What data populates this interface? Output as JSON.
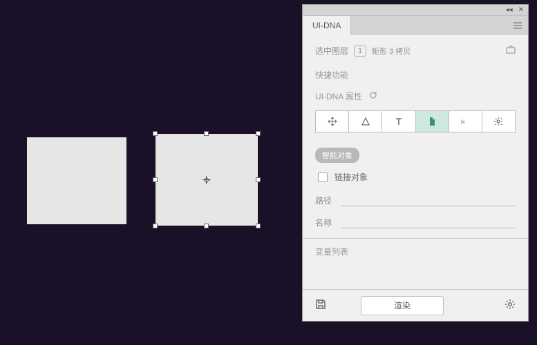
{
  "panel": {
    "tab_label": "UI-DNA",
    "selected_layer_label": "选中图层",
    "selected_count": "1",
    "selected_layer_name": "矩形 3 拷贝",
    "quick_functions_title": "快捷功能",
    "attributes_title": "UI-DNA 属性",
    "smart_object_pill": "智能对象",
    "link_object_label": "链接对象",
    "path_label": "路径",
    "path_value": "",
    "name_label": "名称",
    "name_value": "",
    "variable_list_title": "变量列表",
    "render_button": "渲染"
  },
  "toolbar_buttons": [
    {
      "name": "move-icon"
    },
    {
      "name": "shape-icon"
    },
    {
      "name": "text-icon"
    },
    {
      "name": "document-icon"
    },
    {
      "name": "fx-icon"
    },
    {
      "name": "gear-icon"
    }
  ]
}
